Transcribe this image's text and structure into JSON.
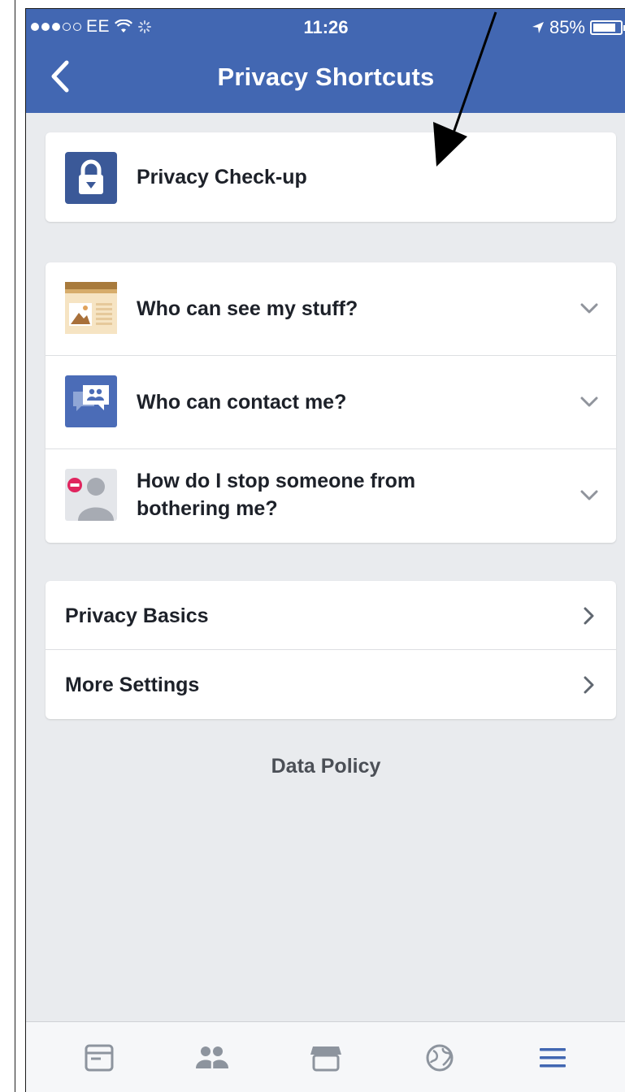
{
  "status_bar": {
    "carrier": "EE",
    "time": "11:26",
    "battery": "85%",
    "battery_level": 0.85
  },
  "nav": {
    "title": "Privacy Shortcuts",
    "back_icon": "chevron-left-icon"
  },
  "check_up": {
    "label": "Privacy Check-up",
    "icon": "lock-icon"
  },
  "shortcuts": [
    {
      "label": "Who can see my stuff?",
      "icon": "profile-card-icon"
    },
    {
      "label": "Who can contact me?",
      "icon": "contact-people-icon"
    },
    {
      "label_line1": "How do I stop someone from",
      "label_line2": "bothering me?",
      "icon": "block-person-icon"
    }
  ],
  "links": [
    {
      "label": "Privacy Basics"
    },
    {
      "label": "More Settings"
    }
  ],
  "footer": {
    "data_policy": "Data Policy"
  },
  "tabbar": [
    "news-feed-icon",
    "friends-icon",
    "marketplace-icon",
    "globe-notifications-icon",
    "menu-icon"
  ],
  "colors": {
    "brand": "#4267b2",
    "background": "#e9ebee",
    "active_tab": "#4267b2"
  }
}
